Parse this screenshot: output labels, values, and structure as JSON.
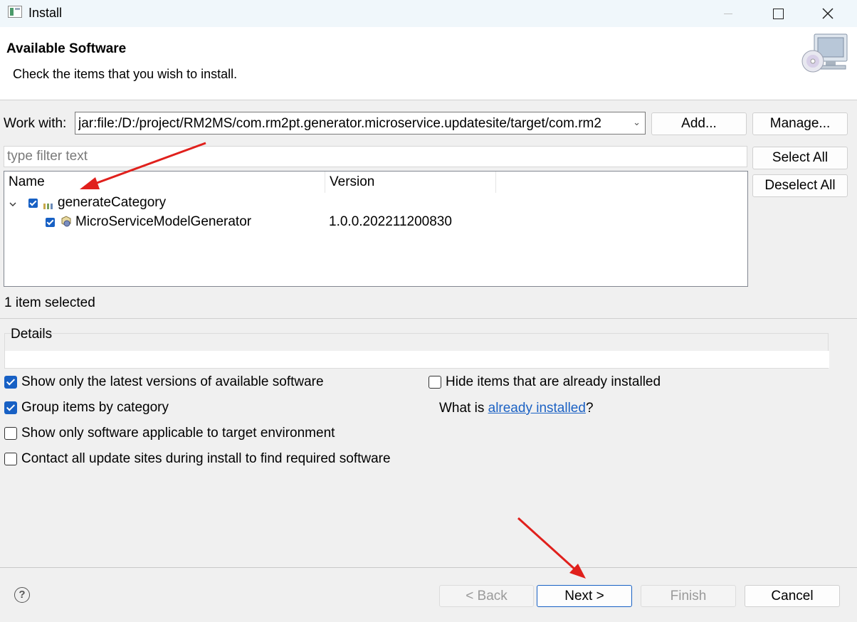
{
  "window": {
    "title": "Install",
    "icon": "eclipse-window-icon",
    "controls": [
      "minimize-icon",
      "maximize-icon",
      "close-icon"
    ]
  },
  "banner": {
    "title": "Available Software",
    "subtitle": "Check the items that you wish to install.",
    "image": "install-cd-monitor-icon"
  },
  "work_with": {
    "label": "Work with:",
    "value": "jar:file:/D:/project/RM2MS/com.rm2pt.generator.microservice.updatesite/target/com.rm2",
    "add_label": "Add...",
    "manage_label": "Manage..."
  },
  "filter": {
    "placeholder": "type filter text"
  },
  "side_buttons": {
    "select_all": "Select All",
    "deselect_all": "Deselect All"
  },
  "tree": {
    "columns": [
      "Name",
      "Version"
    ],
    "rows": [
      {
        "name": "generateCategory",
        "version": "",
        "checked": true,
        "expanded": true,
        "icon": "category-icon"
      },
      {
        "name": "MicroServiceModelGenerator",
        "version": "1.0.0.202211200830",
        "checked": true,
        "icon": "feature-icon"
      }
    ]
  },
  "status": "1 item selected",
  "details": {
    "label": "Details",
    "text": ""
  },
  "options": {
    "latest_versions": {
      "label": "Show only the latest versions of available software",
      "checked": true
    },
    "group_by_category": {
      "label": "Group items by category",
      "checked": true
    },
    "target_env": {
      "label": "Show only software applicable to target environment",
      "checked": false
    },
    "contact_sites": {
      "label": "Contact all update sites during install to find required software",
      "checked": false
    },
    "hide_installed": {
      "label": "Hide items that are already installed",
      "checked": false
    },
    "what_is_prefix": "What is ",
    "what_is_link": "already installed",
    "what_is_suffix": "?"
  },
  "footer": {
    "help_icon": "help-icon",
    "back_label": "< Back",
    "next_label": "Next >",
    "finish_label": "Finish",
    "cancel_label": "Cancel"
  },
  "colors": {
    "accent": "#1760c4",
    "link": "#1c62c4",
    "annotation_arrow": "#e0201c"
  }
}
